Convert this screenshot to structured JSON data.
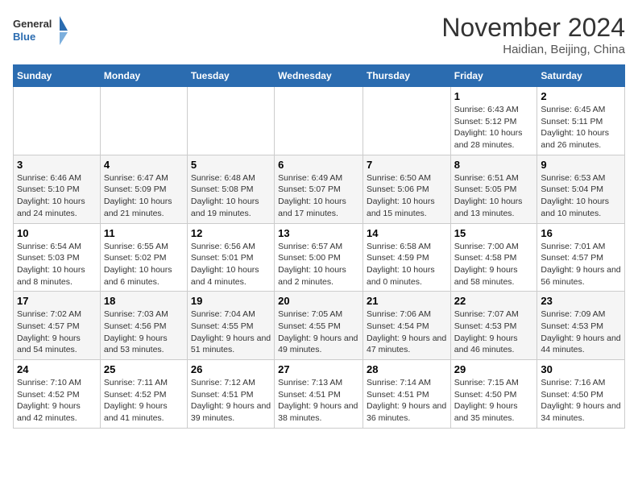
{
  "header": {
    "logo_line1": "General",
    "logo_line2": "Blue",
    "month_title": "November 2024",
    "location": "Haidian, Beijing, China"
  },
  "weekdays": [
    "Sunday",
    "Monday",
    "Tuesday",
    "Wednesday",
    "Thursday",
    "Friday",
    "Saturday"
  ],
  "weeks": [
    [
      {
        "day": "",
        "info": ""
      },
      {
        "day": "",
        "info": ""
      },
      {
        "day": "",
        "info": ""
      },
      {
        "day": "",
        "info": ""
      },
      {
        "day": "",
        "info": ""
      },
      {
        "day": "1",
        "info": "Sunrise: 6:43 AM\nSunset: 5:12 PM\nDaylight: 10 hours and 28 minutes."
      },
      {
        "day": "2",
        "info": "Sunrise: 6:45 AM\nSunset: 5:11 PM\nDaylight: 10 hours and 26 minutes."
      }
    ],
    [
      {
        "day": "3",
        "info": "Sunrise: 6:46 AM\nSunset: 5:10 PM\nDaylight: 10 hours and 24 minutes."
      },
      {
        "day": "4",
        "info": "Sunrise: 6:47 AM\nSunset: 5:09 PM\nDaylight: 10 hours and 21 minutes."
      },
      {
        "day": "5",
        "info": "Sunrise: 6:48 AM\nSunset: 5:08 PM\nDaylight: 10 hours and 19 minutes."
      },
      {
        "day": "6",
        "info": "Sunrise: 6:49 AM\nSunset: 5:07 PM\nDaylight: 10 hours and 17 minutes."
      },
      {
        "day": "7",
        "info": "Sunrise: 6:50 AM\nSunset: 5:06 PM\nDaylight: 10 hours and 15 minutes."
      },
      {
        "day": "8",
        "info": "Sunrise: 6:51 AM\nSunset: 5:05 PM\nDaylight: 10 hours and 13 minutes."
      },
      {
        "day": "9",
        "info": "Sunrise: 6:53 AM\nSunset: 5:04 PM\nDaylight: 10 hours and 10 minutes."
      }
    ],
    [
      {
        "day": "10",
        "info": "Sunrise: 6:54 AM\nSunset: 5:03 PM\nDaylight: 10 hours and 8 minutes."
      },
      {
        "day": "11",
        "info": "Sunrise: 6:55 AM\nSunset: 5:02 PM\nDaylight: 10 hours and 6 minutes."
      },
      {
        "day": "12",
        "info": "Sunrise: 6:56 AM\nSunset: 5:01 PM\nDaylight: 10 hours and 4 minutes."
      },
      {
        "day": "13",
        "info": "Sunrise: 6:57 AM\nSunset: 5:00 PM\nDaylight: 10 hours and 2 minutes."
      },
      {
        "day": "14",
        "info": "Sunrise: 6:58 AM\nSunset: 4:59 PM\nDaylight: 10 hours and 0 minutes."
      },
      {
        "day": "15",
        "info": "Sunrise: 7:00 AM\nSunset: 4:58 PM\nDaylight: 9 hours and 58 minutes."
      },
      {
        "day": "16",
        "info": "Sunrise: 7:01 AM\nSunset: 4:57 PM\nDaylight: 9 hours and 56 minutes."
      }
    ],
    [
      {
        "day": "17",
        "info": "Sunrise: 7:02 AM\nSunset: 4:57 PM\nDaylight: 9 hours and 54 minutes."
      },
      {
        "day": "18",
        "info": "Sunrise: 7:03 AM\nSunset: 4:56 PM\nDaylight: 9 hours and 53 minutes."
      },
      {
        "day": "19",
        "info": "Sunrise: 7:04 AM\nSunset: 4:55 PM\nDaylight: 9 hours and 51 minutes."
      },
      {
        "day": "20",
        "info": "Sunrise: 7:05 AM\nSunset: 4:55 PM\nDaylight: 9 hours and 49 minutes."
      },
      {
        "day": "21",
        "info": "Sunrise: 7:06 AM\nSunset: 4:54 PM\nDaylight: 9 hours and 47 minutes."
      },
      {
        "day": "22",
        "info": "Sunrise: 7:07 AM\nSunset: 4:53 PM\nDaylight: 9 hours and 46 minutes."
      },
      {
        "day": "23",
        "info": "Sunrise: 7:09 AM\nSunset: 4:53 PM\nDaylight: 9 hours and 44 minutes."
      }
    ],
    [
      {
        "day": "24",
        "info": "Sunrise: 7:10 AM\nSunset: 4:52 PM\nDaylight: 9 hours and 42 minutes."
      },
      {
        "day": "25",
        "info": "Sunrise: 7:11 AM\nSunset: 4:52 PM\nDaylight: 9 hours and 41 minutes."
      },
      {
        "day": "26",
        "info": "Sunrise: 7:12 AM\nSunset: 4:51 PM\nDaylight: 9 hours and 39 minutes."
      },
      {
        "day": "27",
        "info": "Sunrise: 7:13 AM\nSunset: 4:51 PM\nDaylight: 9 hours and 38 minutes."
      },
      {
        "day": "28",
        "info": "Sunrise: 7:14 AM\nSunset: 4:51 PM\nDaylight: 9 hours and 36 minutes."
      },
      {
        "day": "29",
        "info": "Sunrise: 7:15 AM\nSunset: 4:50 PM\nDaylight: 9 hours and 35 minutes."
      },
      {
        "day": "30",
        "info": "Sunrise: 7:16 AM\nSunset: 4:50 PM\nDaylight: 9 hours and 34 minutes."
      }
    ]
  ]
}
